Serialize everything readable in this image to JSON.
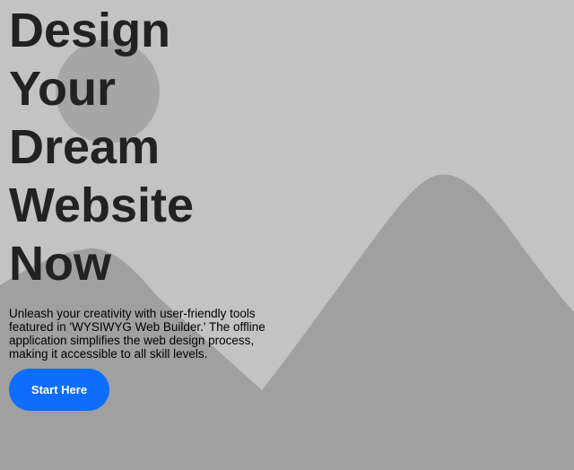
{
  "hero": {
    "title_lines": [
      "Design",
      "Your",
      "Dream",
      "Website",
      "Now"
    ],
    "description": "Unleash your creativity with user-friendly tools featured in 'WYSIWYG Web Builder.' The offline application simplifies the web design process, making it accessible to all skill levels.",
    "cta_label": "Start Here"
  },
  "colors": {
    "background": "#c3c3c3",
    "mountain": "#a0a0a0",
    "sun": "#a6a6a6",
    "title_text": "#222222",
    "cta_background": "#0d6efd",
    "cta_text": "#ffffff"
  },
  "icons": {
    "background_image": "placeholder-landscape-image"
  }
}
